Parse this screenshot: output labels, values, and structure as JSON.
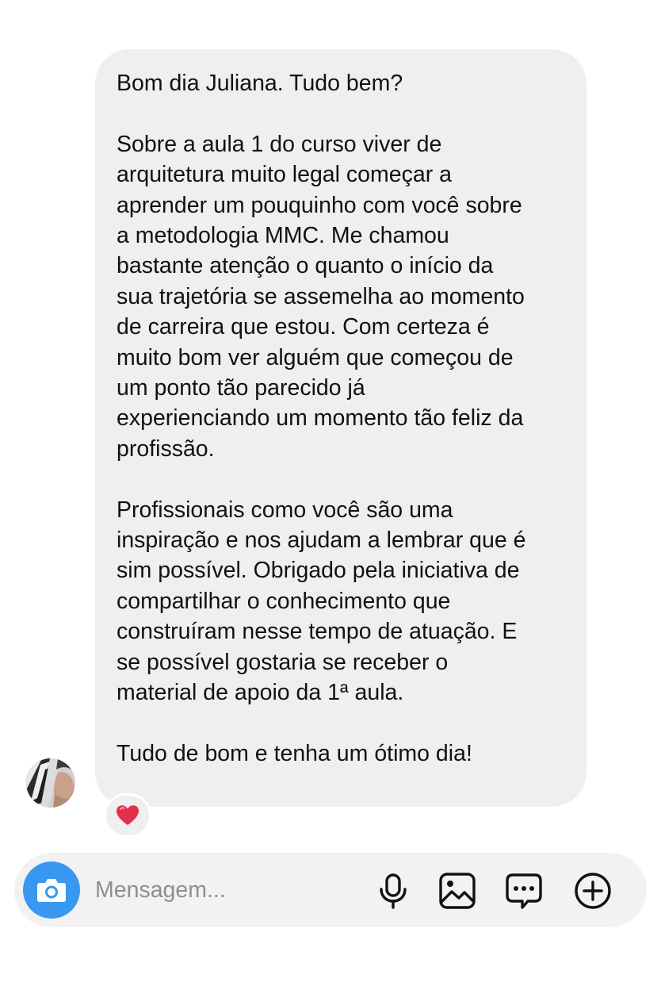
{
  "message": {
    "paragraphs": [
      "Bom dia Juliana. Tudo bem?",
      "Sobre a aula 1 do curso viver de\narquitetura muito legal começar a\naprender um pouquinho com você sobre\na metodologia MMC. Me chamou\nbastante atenção o quanto o início da\nsua trajetória se assemelha ao momento\nde carreira que estou. Com certeza é\nmuito bom ver alguém que começou de\num ponto tão parecido já\nexperienciando um momento tão feliz da\nprofissão.",
      "Profissionais como você são uma\ninspiração e nos ajudam a lembrar que é\nsim possível. Obrigado pela iniciativa de\ncompartilhar o conhecimento que\nconstruíram nesse tempo de atuação. E\nse possível gostaria se receber o\nmaterial de apoio da 1ª aula.",
      "Tudo de bom e tenha um ótimo dia!"
    ],
    "reaction": "❤️",
    "bubble_color": "#efefef"
  },
  "composer": {
    "placeholder": "Mensagem...",
    "camera_color": "#3897f0",
    "icons": [
      "camera-icon",
      "microphone-icon",
      "gallery-icon",
      "sticker-icon",
      "plus-icon"
    ]
  }
}
